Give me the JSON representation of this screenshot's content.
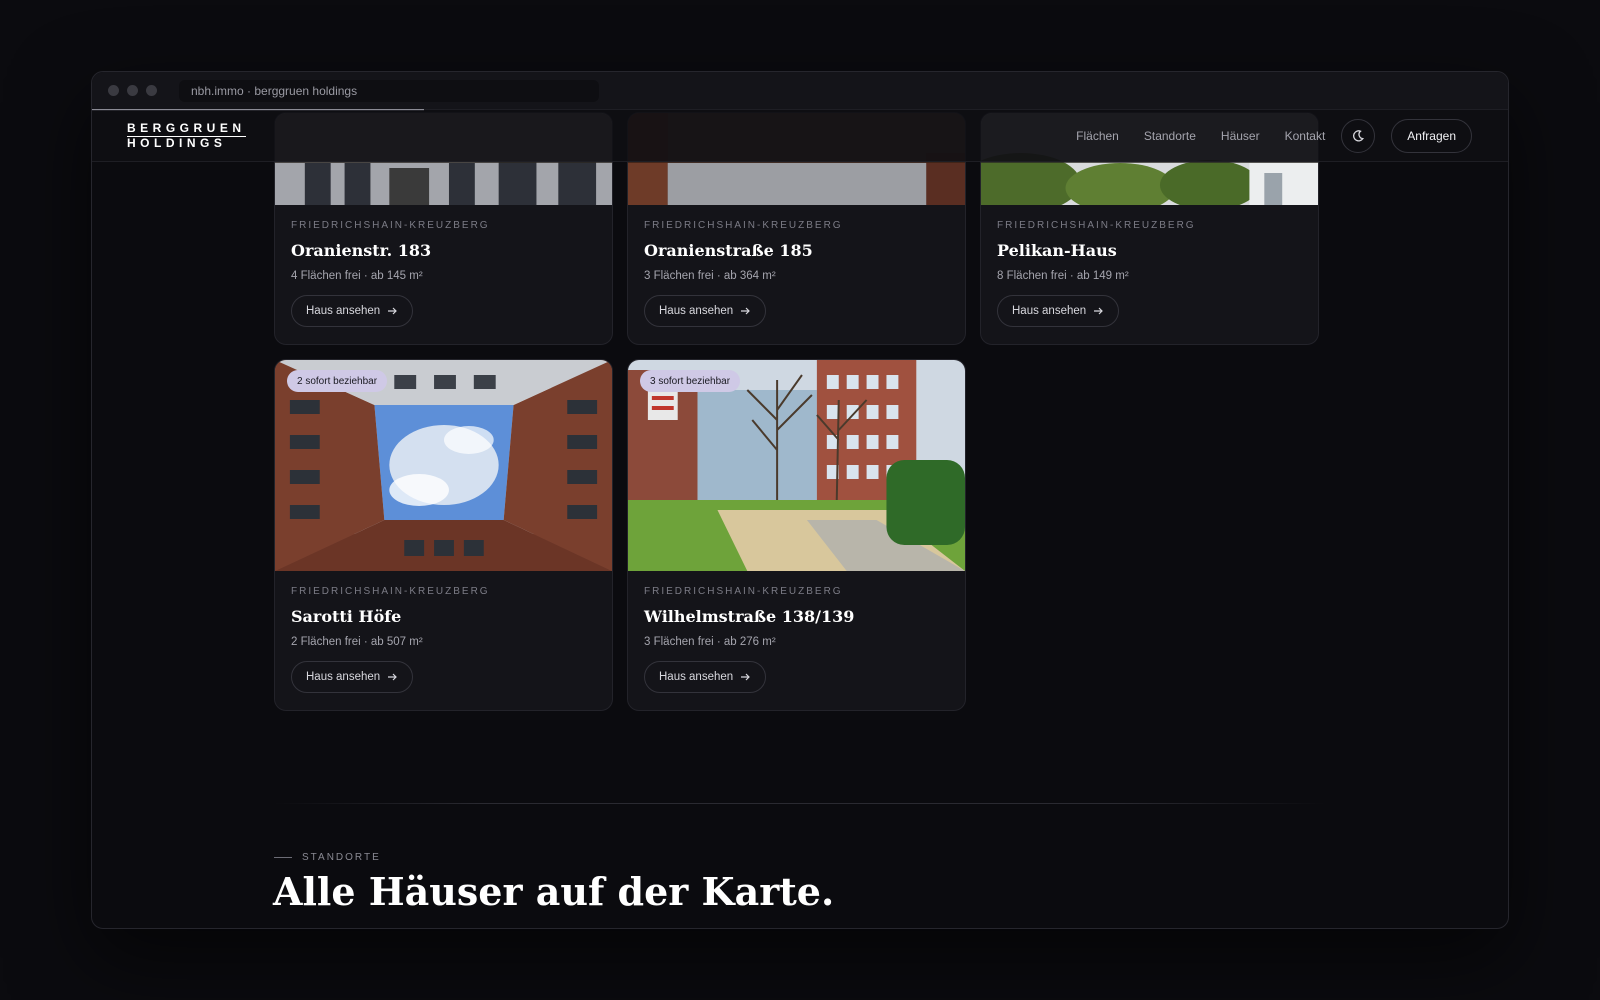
{
  "browser": {
    "url": "nbh.immo · berggruen holdings"
  },
  "nav": {
    "logo_line1": "BERGGRUEN",
    "logo_line2": "HOLDINGS",
    "links": [
      "Flächen",
      "Standorte",
      "Häuser",
      "Kontakt"
    ],
    "cta": "Anfragen"
  },
  "properties": [
    {
      "district": "FRIEDRICHSHAIN-KREUZBERG",
      "name": "Oranienstr. 183",
      "meta": "4 Flächen frei · ab 145 m²",
      "button": "Haus ansehen"
    },
    {
      "district": "FRIEDRICHSHAIN-KREUZBERG",
      "name": "Oranienstraße 185",
      "meta": "3 Flächen frei · ab 364 m²",
      "button": "Haus ansehen"
    },
    {
      "district": "FRIEDRICHSHAIN-KREUZBERG",
      "name": "Pelikan-Haus",
      "meta": "8 Flächen frei · ab 149 m²",
      "button": "Haus ansehen"
    },
    {
      "badge": "2 sofort beziehbar",
      "district": "FRIEDRICHSHAIN-KREUZBERG",
      "name": "Sarotti Höfe",
      "meta": "2 Flächen frei · ab 507 m²",
      "button": "Haus ansehen"
    },
    {
      "badge": "3 sofort beziehbar",
      "district": "FRIEDRICHSHAIN-KREUZBERG",
      "name": "Wilhelmstraße 138/139",
      "meta": "3 Flächen frei · ab 276 m²",
      "button": "Haus ansehen"
    }
  ],
  "section": {
    "eyebrow": "STANDORTE",
    "title": "Alle Häuser auf der Karte."
  },
  "colors": {
    "background": "#0b0b0f",
    "card": "#141419",
    "badge": "#cfc9e6"
  }
}
